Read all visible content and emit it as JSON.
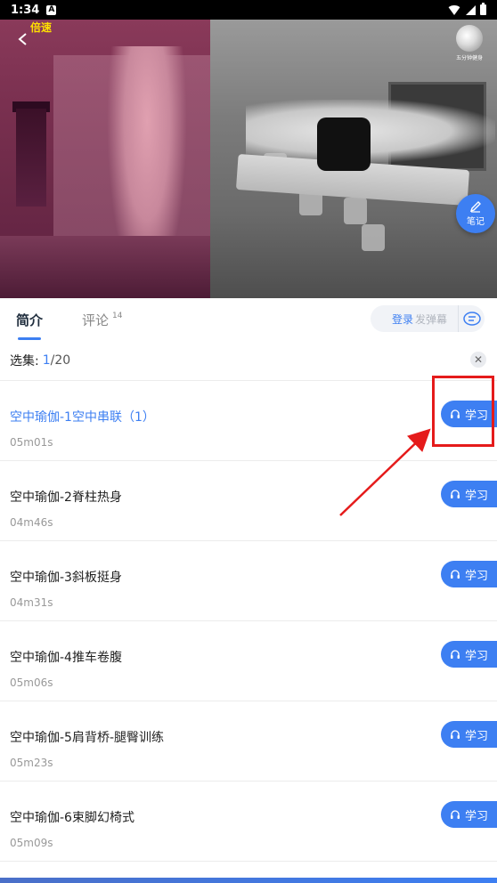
{
  "status_bar": {
    "time": "1:34",
    "notif_icon": "A"
  },
  "video": {
    "top_label": "倍速",
    "logo_text": "五分钟健身",
    "notes_label": "笔记"
  },
  "tabs": [
    {
      "label": "简介",
      "active": true
    },
    {
      "label": "评论",
      "count": "14",
      "active": false
    }
  ],
  "danmu": {
    "login": "登录",
    "send": "发弹幕"
  },
  "episode_select": {
    "label": "选集:",
    "current": "1",
    "total": "/20"
  },
  "episodes": [
    {
      "title": "空中瑜伽-1空中串联（1）",
      "duration": "05m01s",
      "active": true,
      "button": "学习"
    },
    {
      "title": "空中瑜伽-2脊柱热身",
      "duration": "04m46s",
      "active": false,
      "button": "学习"
    },
    {
      "title": "空中瑜伽-3斜板挺身",
      "duration": "04m31s",
      "active": false,
      "button": "学习"
    },
    {
      "title": "空中瑜伽-4推车卷腹",
      "duration": "05m06s",
      "active": false,
      "button": "学习"
    },
    {
      "title": "空中瑜伽-5肩背桥-腿臀训练",
      "duration": "05m23s",
      "active": false,
      "button": "学习"
    },
    {
      "title": "空中瑜伽-6束脚幻椅式",
      "duration": "05m09s",
      "active": false,
      "button": "学习"
    }
  ],
  "colors": {
    "accent": "#3d7ff2",
    "annotation": "#e51b1b"
  }
}
